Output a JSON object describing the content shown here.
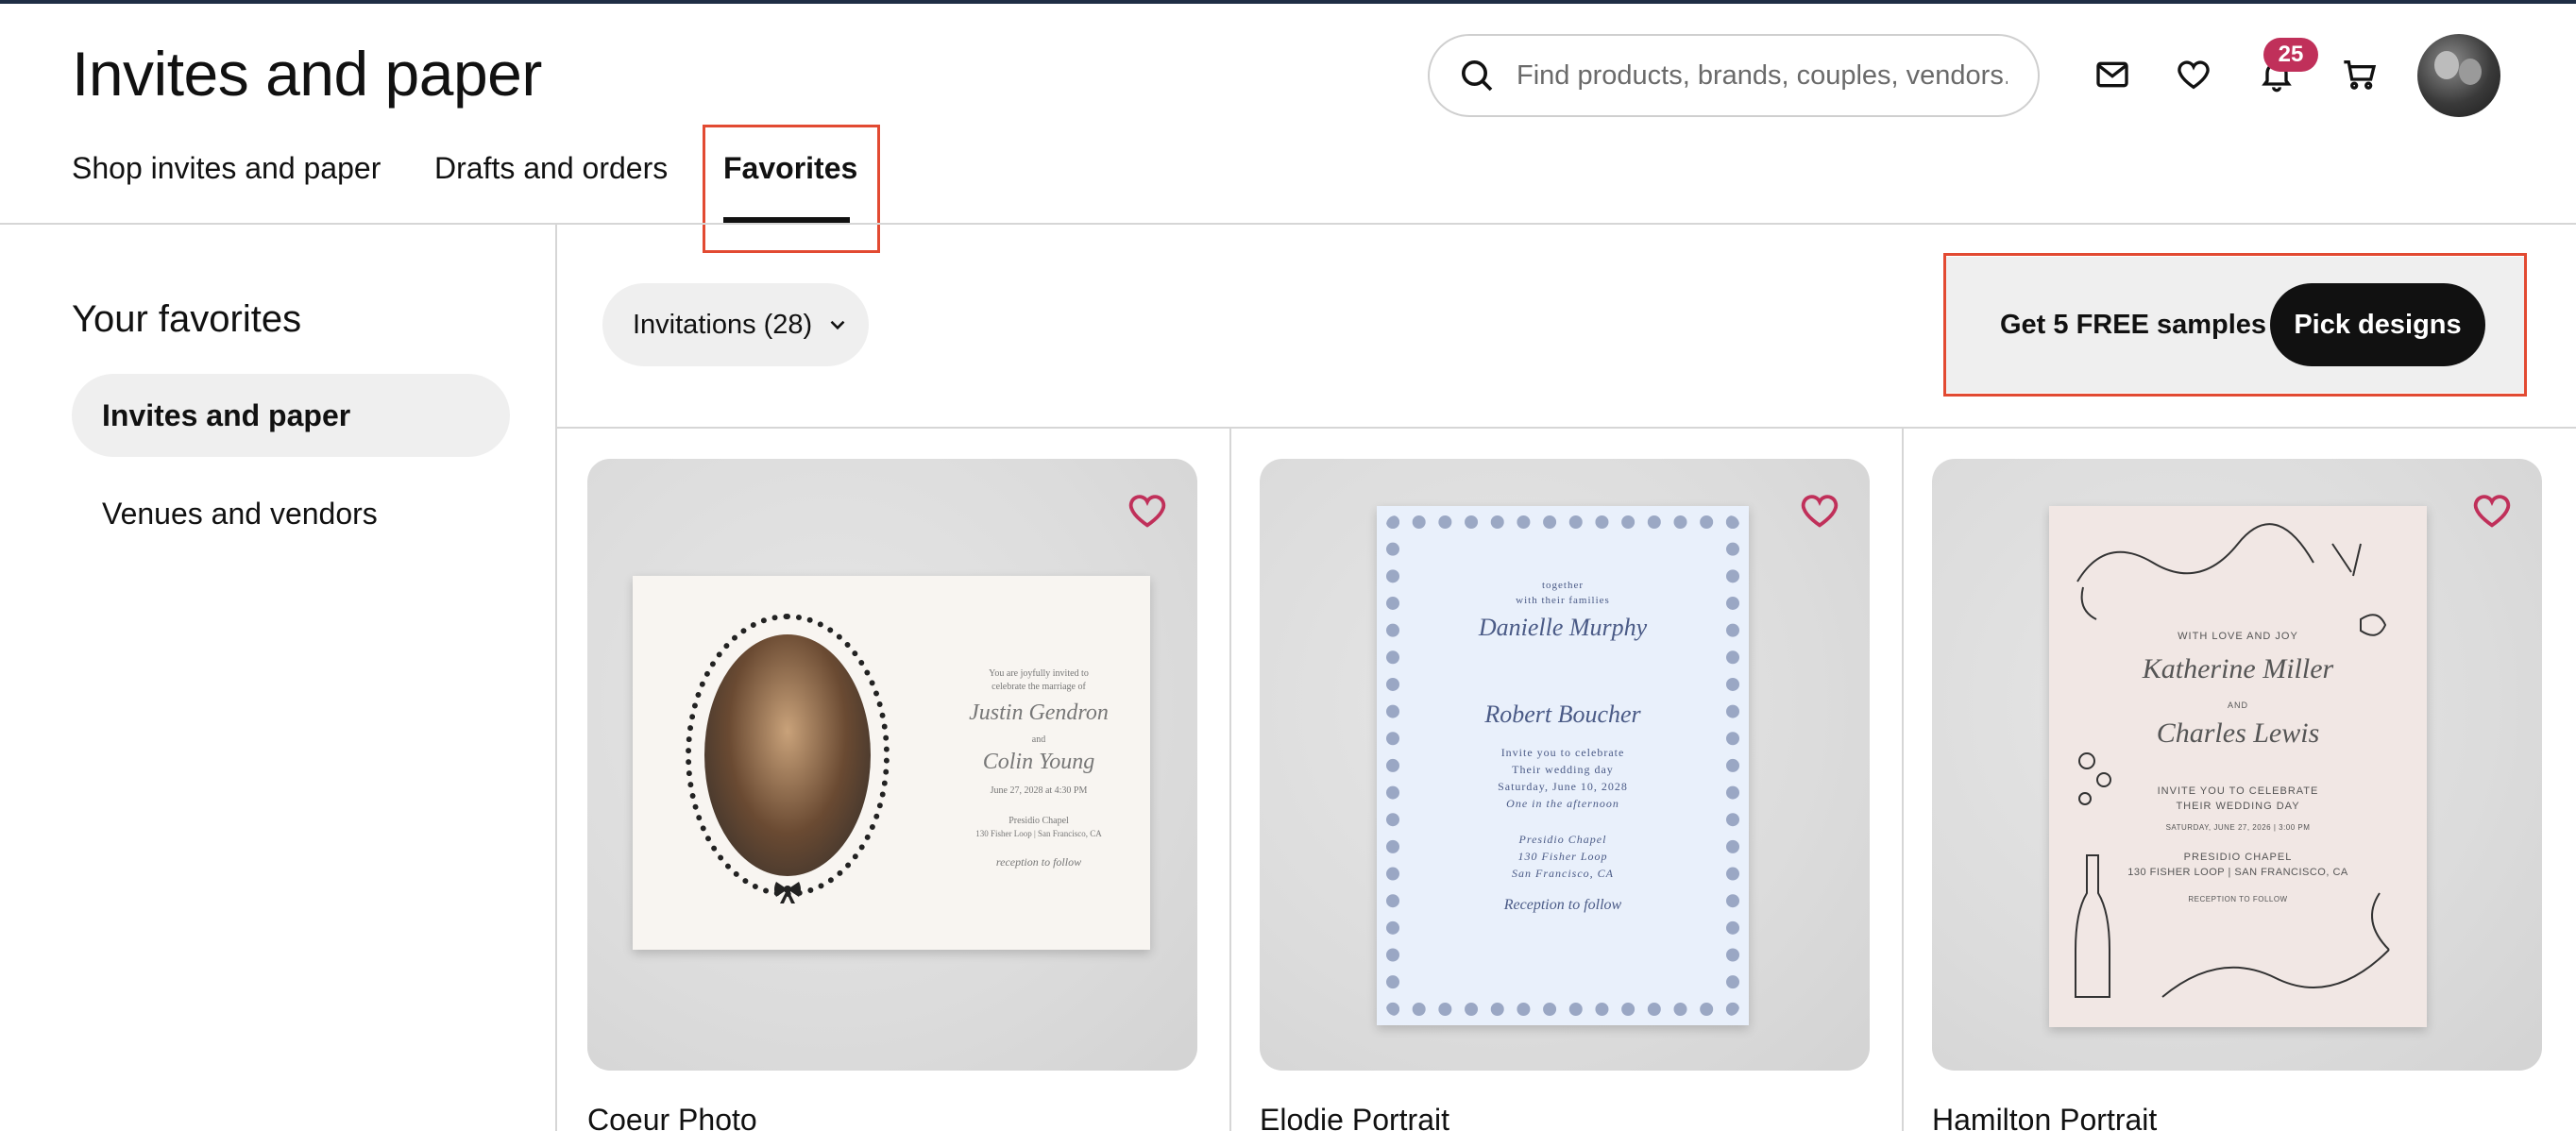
{
  "header": {
    "title": "Invites and paper",
    "search_placeholder": "Find products, brands, couples, vendors...",
    "notification_count": "25",
    "icons": [
      "search-icon",
      "mail-icon",
      "heart-icon",
      "bell-icon",
      "cart-icon",
      "avatar"
    ]
  },
  "tabs": [
    {
      "label": "Shop invites and paper",
      "active": false
    },
    {
      "label": "Drafts and orders",
      "active": false
    },
    {
      "label": "Favorites",
      "active": true
    }
  ],
  "sidebar": {
    "title": "Your favorites",
    "items": [
      {
        "label": "Invites and paper",
        "active": true
      },
      {
        "label": "Venues and vendors",
        "active": false
      }
    ]
  },
  "toolbar": {
    "filter_label": "Invitations (28)",
    "samples_text": "Get 5 FREE samples",
    "pick_button": "Pick designs"
  },
  "cards": [
    {
      "name": "Coeur Photo",
      "lines": [
        "You are joyfully invited to",
        "celebrate the marriage of",
        "Justin Gendron",
        "and",
        "Colin Young",
        "June 27, 2028 at 4:30 PM",
        "Presidio Chapel",
        "130 Fisher Loop | San Francisco, CA",
        "reception to follow"
      ]
    },
    {
      "name": "Elodie Portrait",
      "lines": [
        "together",
        "with their families",
        "Danielle Murphy",
        "Robert Boucher",
        "Invite you to celebrate",
        "Their wedding day",
        "Saturday, June 10, 2028",
        "One in the afternoon",
        "Presidio Chapel",
        "130 Fisher Loop",
        "San Francisco, CA",
        "Reception to follow"
      ]
    },
    {
      "name": "Hamilton Portrait",
      "lines": [
        "WITH LOVE AND JOY",
        "Katherine Miller",
        "AND",
        "Charles Lewis",
        "INVITE YOU TO CELEBRATE",
        "THEIR WEDDING DAY",
        "SATURDAY, JUNE 27, 2026 | 3:00 PM",
        "PRESIDIO CHAPEL",
        "130 FISHER LOOP | SAN FRANCISCO, CA",
        "RECEPTION TO FOLLOW"
      ]
    }
  ],
  "colors": {
    "accent_highlight": "#e24a32",
    "badge": "#c0305a",
    "heart": "#c0305a",
    "primary_button": "#111111"
  }
}
